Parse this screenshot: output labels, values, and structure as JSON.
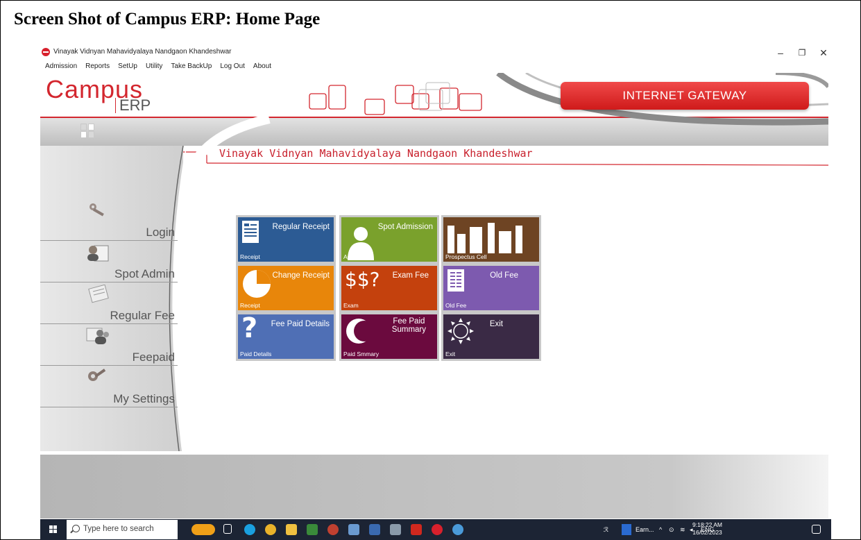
{
  "caption": "Screen Shot of  Campus ERP: Home Page",
  "window": {
    "title": "Vinayak Vidnyan Mahavidyalaya Nandgaon Khandeshwar",
    "min": "–",
    "restore": "❐",
    "close": "✕"
  },
  "menu": [
    "Admission",
    "Reports",
    "SetUp",
    "Utility",
    "Take BackUp",
    "Log Out",
    "About"
  ],
  "header": {
    "logo_main": "Campus",
    "logo_sub": "ERP",
    "gateway": "INTERNET GATEWAY",
    "college": "Vinayak Vidnyan Mahavidyalaya Nandgaon Khandeshwar"
  },
  "sidebar": [
    "Login",
    "Spot Admin",
    "Regular Fee",
    "Feepaid",
    "My Settings"
  ],
  "tiles": [
    {
      "title": "Regular Receipt",
      "foot": "Receipt",
      "color": "#2c5b94",
      "icon": "document-icon"
    },
    {
      "title": "Spot Admission",
      "foot": "Admission",
      "color": "#7aa12c",
      "icon": "person-icon"
    },
    {
      "title": "",
      "foot": "Prospectus Cell",
      "color": "#6e4423",
      "icon": "city-icon"
    },
    {
      "title": "Change Receipt",
      "foot": "Receipt",
      "color": "#e8860a",
      "icon": "pie-icon"
    },
    {
      "title": "Exam Fee",
      "foot": "Exam",
      "color": "#c4410d",
      "icon": "dollar-icon",
      "icon_text": "$$?"
    },
    {
      "title": "Old Fee",
      "foot": "Old Fee",
      "color": "#7d5aaf",
      "icon": "book-icon"
    },
    {
      "title": "Fee Paid Details",
      "foot": "Paid Details",
      "color": "#4f6fb5",
      "icon": "question-icon",
      "icon_text": "?"
    },
    {
      "title": "Fee Paid\nSummary",
      "foot": "Paid Smmary",
      "color": "#6b0a3e",
      "icon": "moon-icon"
    },
    {
      "title": "Exit",
      "foot": "Exit",
      "color": "#3a2a45",
      "icon": "sun-icon"
    }
  ],
  "taskbar": {
    "search_placeholder": "Type here to search",
    "tray_app": "Earn...",
    "lang": "ENG",
    "time": "9:18:22 AM",
    "date": "16/02/2023"
  }
}
